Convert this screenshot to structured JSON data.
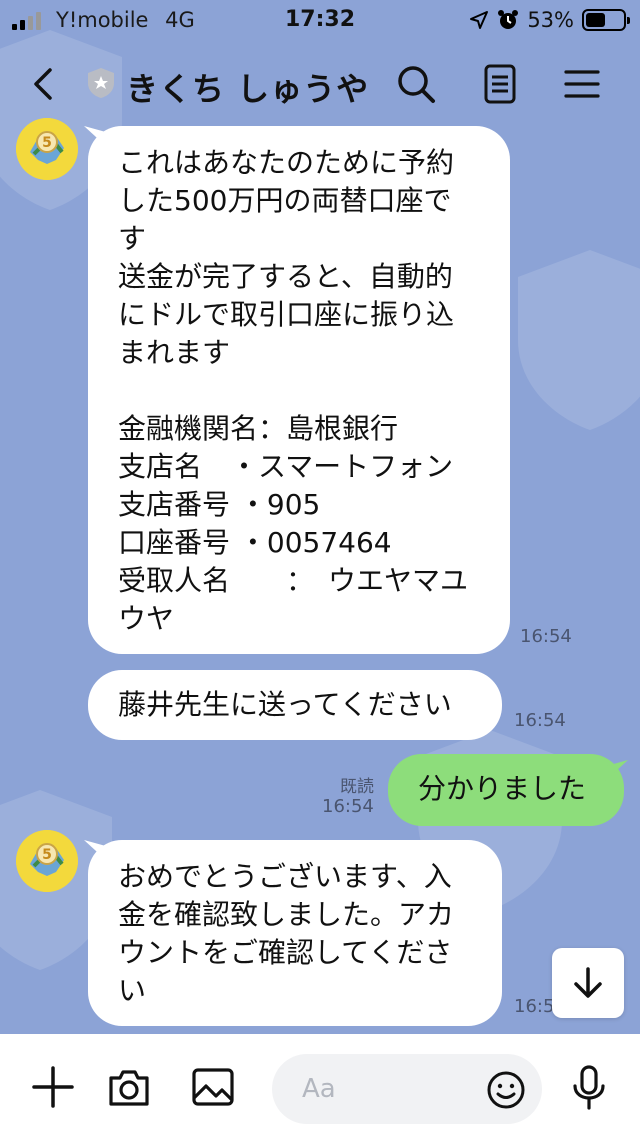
{
  "status_bar": {
    "carrier": "Y!mobile",
    "network": "4G",
    "time": "17:32",
    "battery_percent": "53%",
    "battery_level": 0.53
  },
  "header": {
    "title": "きくち しゅうや"
  },
  "messages": [
    {
      "direction": "incoming",
      "text": "これはあなたのために予約\nした500万円の両替口座で\nす\n送金が完了すると、自動的\nにドルで取引口座に振り込\nまれます\n\n金融機関名：島根銀行\n支店名　・スマートフォン\n支店番号 ・905\n口座番号 ・0057464\n受取人名　　：　ウエヤマユ\nウヤ",
      "time": "16:54"
    },
    {
      "direction": "incoming",
      "text": "藤井先生に送ってください",
      "time": "16:54"
    },
    {
      "direction": "outgoing",
      "text": "分かりました",
      "read_label": "既読",
      "time": "16:54"
    },
    {
      "direction": "incoming",
      "text": "おめでとうございます、入\n金を確認致しました。アカ\nウントをご確認してくださ\nい",
      "time": "16:5"
    }
  ],
  "avatar_badge": "5",
  "composer": {
    "placeholder": "Aa"
  },
  "colors": {
    "background": "#8ca3d6",
    "incoming_bubble": "#ffffff",
    "outgoing_bubble": "#8ddd7b",
    "composer": "#ffffff"
  },
  "icons": [
    "back-icon",
    "shield-badge-icon",
    "search-icon",
    "note-icon",
    "menu-icon",
    "plus-icon",
    "camera-icon",
    "image-icon",
    "emoji-icon",
    "microphone-icon",
    "arrow-down-icon"
  ]
}
